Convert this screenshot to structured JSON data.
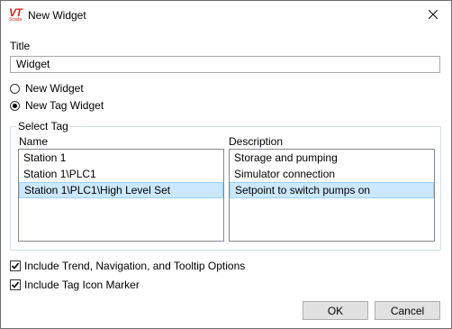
{
  "window": {
    "title": "New Widget",
    "logo_text": "VT",
    "logo_subtext": "Scada"
  },
  "form": {
    "title_label": "Title",
    "title_value": "Widget",
    "radio_new_widget": "New Widget",
    "radio_new_tag_widget": "New Tag Widget",
    "selected_radio": "New Tag Widget"
  },
  "select_tag": {
    "group_label": "Select Tag",
    "name_header": "Name",
    "description_header": "Description",
    "names": [
      "Station 1",
      "Station 1\\PLC1",
      "Station 1\\PLC1\\High Level Set"
    ],
    "descriptions": [
      "Storage and pumping",
      "Simulator connection",
      "Setpoint to switch pumps on"
    ],
    "selected_index": 2
  },
  "options": {
    "include_trend_label": "Include Trend, Navigation, and Tooltip Options",
    "include_trend_checked": true,
    "include_icon_label": "Include Tag Icon Marker",
    "include_icon_checked": true
  },
  "buttons": {
    "ok": "OK",
    "cancel": "Cancel"
  },
  "colors": {
    "selection": "#cce8ff",
    "logo": "#d9241c"
  }
}
